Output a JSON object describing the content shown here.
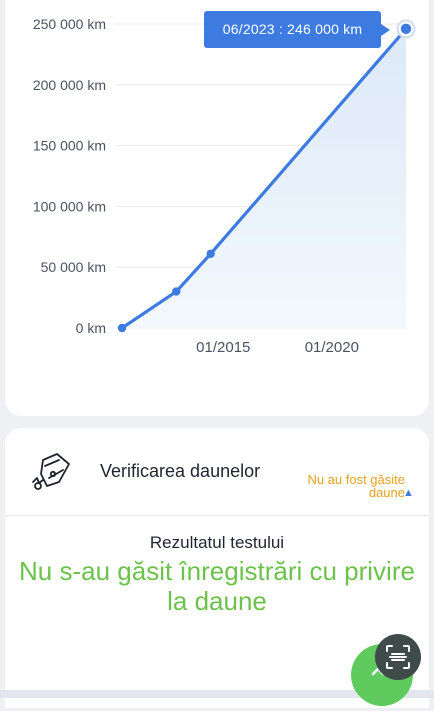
{
  "mileage_chart": {
    "chart_data": {
      "type": "line",
      "y_tick_labels": [
        "250 000 km",
        "200 000 km",
        "150 000 km",
        "100 000 km",
        "50 000 km",
        "0 km"
      ],
      "x_tick_labels": [
        "01/2015",
        "01/2020"
      ],
      "ylim": [
        0,
        250000
      ],
      "points": [
        {
          "x": "2010-05",
          "y": 0
        },
        {
          "x": "2012-11",
          "y": 30000
        },
        {
          "x": "2014-06",
          "y": 61000
        },
        {
          "x": "2023-06",
          "y": 246000
        }
      ],
      "grid": true
    },
    "tooltip_text": "06/2023 : 246 000 km"
  },
  "damage_section": {
    "title": "Verificarea daunelor",
    "status_line1": "Nu au fost găsite",
    "status_line2": "daune",
    "result_label": "Rezultatul testului",
    "result_message": "Nu s-au găsit înregistrări cu privire la daune"
  },
  "icons": {
    "damage": "car-damage-icon",
    "chevron": "chevron-up-icon",
    "scan": "scan-icon",
    "fab": "scroll-top-icon"
  },
  "colors": {
    "accent": "#3e7be0",
    "status_warning": "#e8a21e",
    "success": "#6cc24a"
  }
}
